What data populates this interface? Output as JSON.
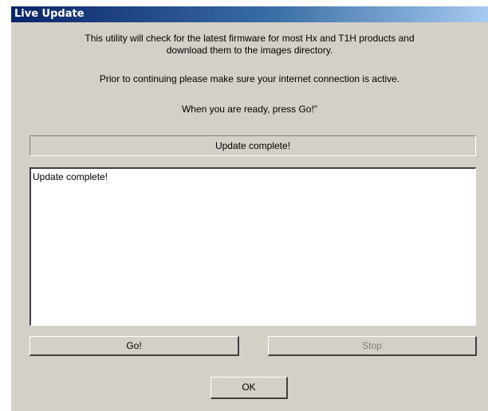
{
  "window": {
    "title": "Live Update"
  },
  "info": {
    "line1": "This utility will check for the latest firmware for most Hx and T1H products and",
    "line2": "download them to the images directory.",
    "line3": "Prior to continuing please make sure your internet connection is active.",
    "line4": "When you are ready, press Go!\""
  },
  "status": {
    "text": "Update complete!"
  },
  "log": {
    "text": "Update complete!"
  },
  "buttons": {
    "go": "Go!",
    "stop": "Stop",
    "ok": "OK"
  }
}
